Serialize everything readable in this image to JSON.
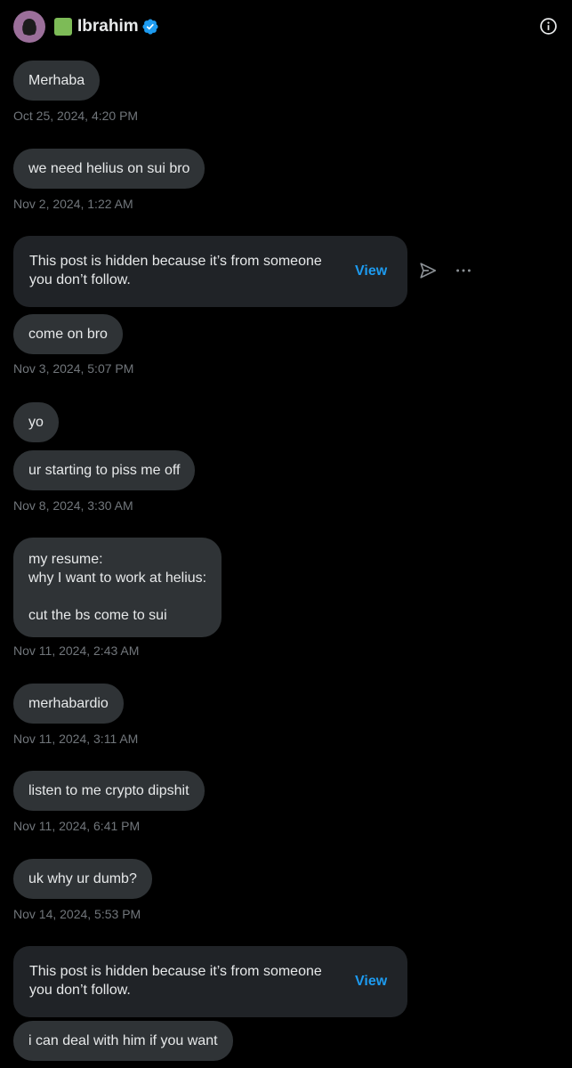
{
  "header": {
    "name": "Ibrahim",
    "avatar_icon": "profile-avatar",
    "badge_icon": "green-square-emoji",
    "verified_icon": "verified-badge-icon",
    "info_icon": "info-icon"
  },
  "colors": {
    "background": "#000000",
    "bubble": "#2f3336",
    "hidden_card": "#202327",
    "text": "#e7e9ea",
    "timestamp": "#71767b",
    "link": "#1d9bf0",
    "verified": "#1d9bf0"
  },
  "messages": [
    {
      "text": "Merhaba",
      "time": "Oct 25, 2024, 4:20 PM"
    },
    {
      "text": "we need helius on sui bro",
      "time": "Nov 2, 2024, 1:22 AM"
    },
    {
      "hidden_text": "This post is hidden because it’s from someone\nyou don’t follow.",
      "view_label": "View"
    },
    {
      "text": "come on bro",
      "time": "Nov 3, 2024, 5:07 PM"
    },
    {
      "text": "yo"
    },
    {
      "text": "ur starting to piss me off",
      "time": "Nov 8, 2024, 3:30 AM"
    },
    {
      "text": "my resume:\nwhy I want to work at helius:\n\ncut the bs come to sui",
      "time": "Nov 11, 2024, 2:43 AM"
    },
    {
      "text": "merhabardio",
      "time": "Nov 11, 2024, 3:11 AM"
    },
    {
      "text": "listen to me crypto dipshit",
      "time": "Nov 11, 2024, 6:41 PM"
    },
    {
      "text": "uk why ur dumb?",
      "time": "Nov 14, 2024, 5:53 PM"
    },
    {
      "hidden_text": "This post is hidden because it’s from someone\nyou don’t follow.",
      "view_label": "View"
    },
    {
      "text": "i can deal with him if you want"
    }
  ],
  "hidden_post_actions": {
    "share_icon": "send-icon",
    "more_icon": "more-options-icon"
  }
}
